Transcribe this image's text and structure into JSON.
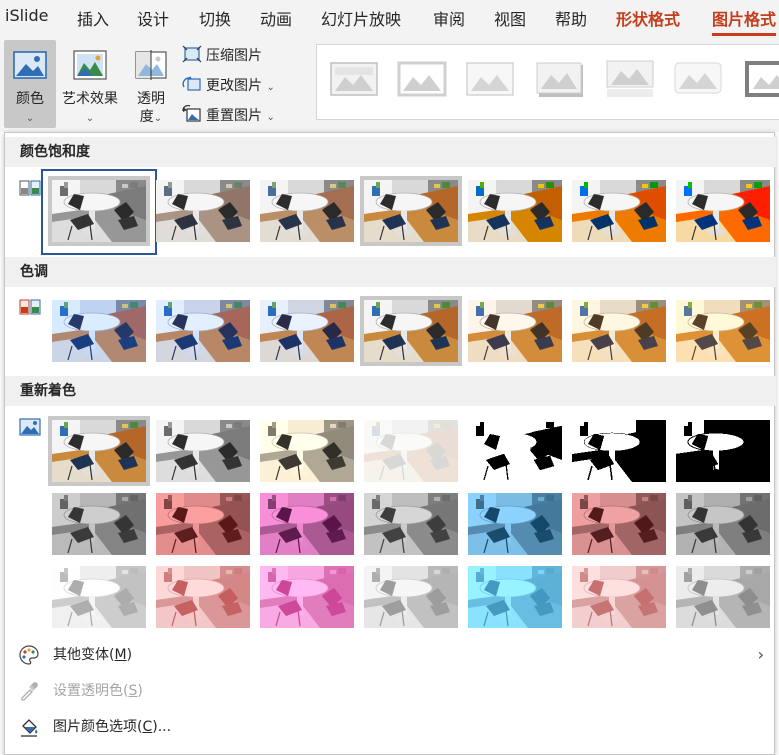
{
  "tabs": [
    {
      "label": "iSlide"
    },
    {
      "label": "插入"
    },
    {
      "label": "设计"
    },
    {
      "label": "切换"
    },
    {
      "label": "动画"
    },
    {
      "label": "幻灯片放映"
    },
    {
      "label": "审阅"
    },
    {
      "label": "视图"
    },
    {
      "label": "帮助"
    },
    {
      "label": "形状格式"
    },
    {
      "label": "图片格式"
    }
  ],
  "ribbon": {
    "color_label": "颜色",
    "artistic_label": "艺术效果",
    "transparency_label_1": "透明",
    "transparency_label_2": "度",
    "compress_label": "压缩图片",
    "change_label": "更改图片",
    "reset_label": "重置图片",
    "caret": "⌄"
  },
  "panel": {
    "saturation_header": "颜色饱和度",
    "tone_header": "色调",
    "recolor_header": "重新着色",
    "more_variations": {
      "label": "其他变体(",
      "key": "M",
      "suffix": ")",
      "chevron": "›"
    },
    "set_transparent": {
      "label": "设置透明色(",
      "key": "S",
      "suffix": ")"
    },
    "color_options": {
      "label": "图片颜色选项(",
      "key": "C",
      "suffix": ")..."
    }
  },
  "colors": {
    "accent": "#c43e1c",
    "selection_frame": "#2b579a",
    "ribbon_bg": "#f3f3f3",
    "section_bg": "#f0f0f0"
  }
}
